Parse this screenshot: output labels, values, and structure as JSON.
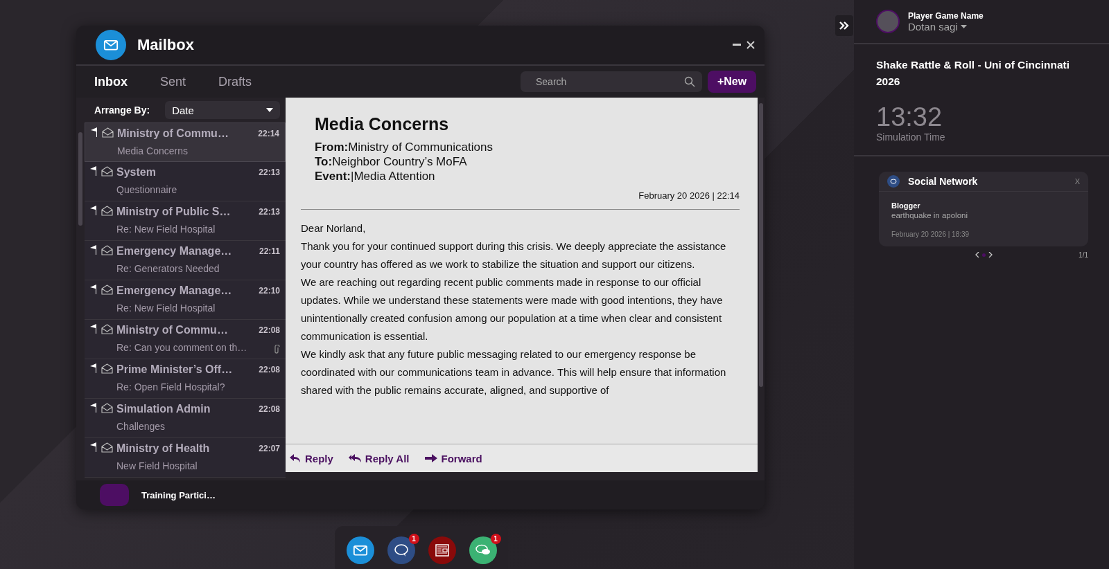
{
  "mailbox": {
    "title": "Mailbox",
    "tabs": [
      {
        "label": "Inbox",
        "selected": true
      },
      {
        "label": "Sent",
        "selected": false
      },
      {
        "label": "Drafts",
        "selected": false
      }
    ],
    "search": {
      "placeholder": "Search"
    },
    "new_button": "+New",
    "arrange_by": {
      "label": "Arrange By:",
      "value": "Date"
    },
    "messages": [
      {
        "sender": "Ministry of Commu…",
        "subject": "Media Concerns",
        "time": "22:14",
        "selected": true,
        "attachment": false
      },
      {
        "sender": "System",
        "subject": "Questionnaire",
        "time": "22:13",
        "selected": false,
        "attachment": false
      },
      {
        "sender": "Ministry of Public S…",
        "subject": "Re: New Field Hospital",
        "time": "22:13",
        "selected": false,
        "attachment": false
      },
      {
        "sender": "Emergency Manage…",
        "subject": "Re: Generators Needed",
        "time": "22:11",
        "selected": false,
        "attachment": false
      },
      {
        "sender": "Emergency Manage…",
        "subject": "Re: New Field Hospital",
        "time": "22:10",
        "selected": false,
        "attachment": false
      },
      {
        "sender": "Ministry of Commu…",
        "subject": "Re: Can you comment on th…",
        "time": "22:08",
        "selected": false,
        "attachment": true
      },
      {
        "sender": "Prime Minister’s Off…",
        "subject": "Re: Open Field Hospital?",
        "time": "22:08",
        "selected": false,
        "attachment": false
      },
      {
        "sender": "Simulation Admin",
        "subject": "Challenges",
        "time": "22:08",
        "selected": false,
        "attachment": false
      },
      {
        "sender": "Ministry of Health",
        "subject": "New Field Hospital",
        "time": "22:07",
        "selected": false,
        "attachment": false
      }
    ],
    "message": {
      "subject": "Media Concerns",
      "from_label": "From:",
      "from": "Ministry of Communications",
      "to_label": "To:",
      "to": "Neighbor Country’s MoFA",
      "event_label": "Event:",
      "event": "|Media Attention",
      "date": "February 20 2026 | 22:14",
      "body": [
        "Dear Norland,",
        "Thank you for your continued support during this crisis. We deeply appreciate the assistance your country has offered as we work to stabilize the situation and support our citizens.",
        "We are reaching out regarding recent public comments made in response to our official updates. While we understand these statements were made with good intentions, they have unintentionally created confusion among our population at a time when clear and consistent communication is essential.",
        "We kindly ask that any future public messaging related to our emergency response be coordinated with our communications team in advance. This will help ensure that information shared with the public remains accurate, aligned, and supportive of"
      ],
      "actions": [
        {
          "kind": "reply",
          "label": "Reply"
        },
        {
          "kind": "reply_all",
          "label": "Reply All"
        },
        {
          "kind": "forward",
          "label": "Forward"
        }
      ]
    },
    "participant": "Training Partici…"
  },
  "side_panel": {
    "player_label": "Player Game Name",
    "player_name": "Dotan sagi",
    "simulation_title": "Shake Rattle & Roll - Uni of Cincinnati 2026",
    "time": "13:32",
    "time_label": "Simulation Time",
    "notification": {
      "title": "Social Network",
      "close": "X",
      "author": "Blogger",
      "text": "earthquake in apoloni",
      "date": "February 20 2026 | 18:39",
      "pages": [
        {
          "selected": true
        }
      ],
      "page_count": "1/1"
    }
  },
  "dock": [
    {
      "kind": "mail"
    },
    {
      "kind": "social",
      "badge": "1"
    },
    {
      "kind": "news"
    },
    {
      "kind": "chat",
      "badge": "1"
    }
  ]
}
